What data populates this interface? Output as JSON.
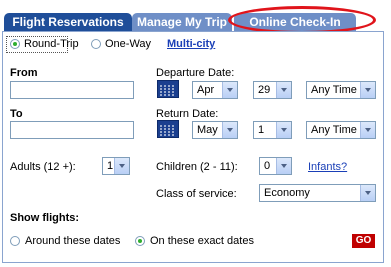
{
  "tabs": [
    {
      "label": "Flight Reservations",
      "active": true
    },
    {
      "label": "Manage My Trip",
      "active": false
    },
    {
      "label": "Online Check-In",
      "active": false
    }
  ],
  "colors": {
    "tab_active": "#1f4e99",
    "tab_inactive": "#6f8fc7",
    "highlight_oval": "#e0141b",
    "link": "#1a3fb7",
    "go_button": "#c00000"
  },
  "trip_type": {
    "round_trip": "Round-Trip",
    "one_way": "One-Way",
    "multi_city": "Multi-city",
    "selected": "Round-Trip"
  },
  "from": {
    "label": "From",
    "value": ""
  },
  "to": {
    "label": "To",
    "value": ""
  },
  "departure": {
    "label": "Departure Date:",
    "month": "Apr",
    "day": "29",
    "time": "Any Time",
    "calendar_icon": "calendar-icon"
  },
  "return": {
    "label": "Return Date:",
    "month": "May",
    "day": "1",
    "time": "Any Time",
    "calendar_icon": "calendar-icon"
  },
  "adults": {
    "label": "Adults (12 +):",
    "value": "1"
  },
  "children": {
    "label": "Children (2 - 11):",
    "value": "0"
  },
  "infants_link": "Infants?",
  "class_of_service": {
    "label": "Class of service:",
    "value": "Economy"
  },
  "show_flights": {
    "label": "Show flights:",
    "around": "Around these dates",
    "exact": "On these exact dates",
    "selected": "On these exact dates"
  },
  "go_button": "GO"
}
